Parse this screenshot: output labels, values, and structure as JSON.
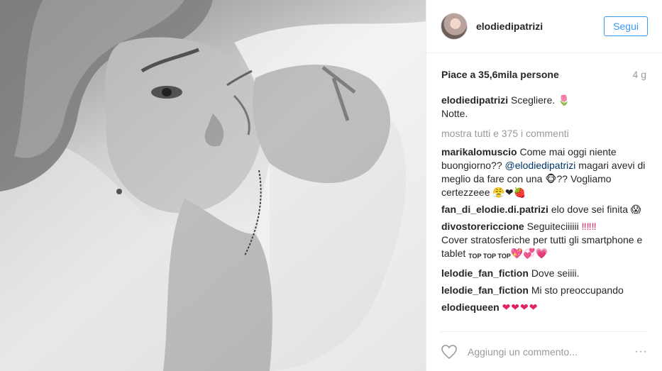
{
  "post": {
    "username": "elodiedipatrizi",
    "follow_label": "Segui",
    "likes_text": "Piace a 35,6mila persone",
    "time_ago": "4 g",
    "caption_user": "elodiedipatrizi",
    "caption_line1": "Scegliere. ",
    "caption_emoji": "🌷",
    "caption_line2": "Notte.",
    "load_more": "mostra tutti e 375 i commenti",
    "add_comment_placeholder": "Aggiungi un commento...",
    "more_options": "···"
  },
  "comments": [
    {
      "user": "marikalomuscio",
      "part1": "Come mai oggi niente buongiorno?? ",
      "mention": "@elodiedipatrizi",
      "part2": " magari avevi di meglio da fare con una ",
      "emoji1": "🐵",
      "part3": "?? Vogliamo certezzeee ",
      "emoji2": "😤",
      "emoji3": "❤",
      "emoji4": "🍓"
    },
    {
      "user": "fan_di_elodie.di.patrizi",
      "text": "elo dove sei finita ",
      "emoji": "😱"
    },
    {
      "user": "divostorericcione",
      "text1": "Seguiteciiiiii ",
      "emoji1": "‼‼‼",
      "text2": "Cover stratosferiche per tutti gli smartphone e tablet ",
      "top_icons": "TOP TOP TOP",
      "emoji2": "💖💞💗"
    },
    {
      "user": "lelodie_fan_fiction",
      "text": "Dove seiiii."
    },
    {
      "user": "lelodie_fan_fiction",
      "text": "Mi sto preoccupando"
    },
    {
      "user": "elodiequeen",
      "emoji": "❤❤❤❤"
    }
  ],
  "colors": {
    "accent": "#3897f0",
    "link": "#003569",
    "muted": "#999999"
  }
}
